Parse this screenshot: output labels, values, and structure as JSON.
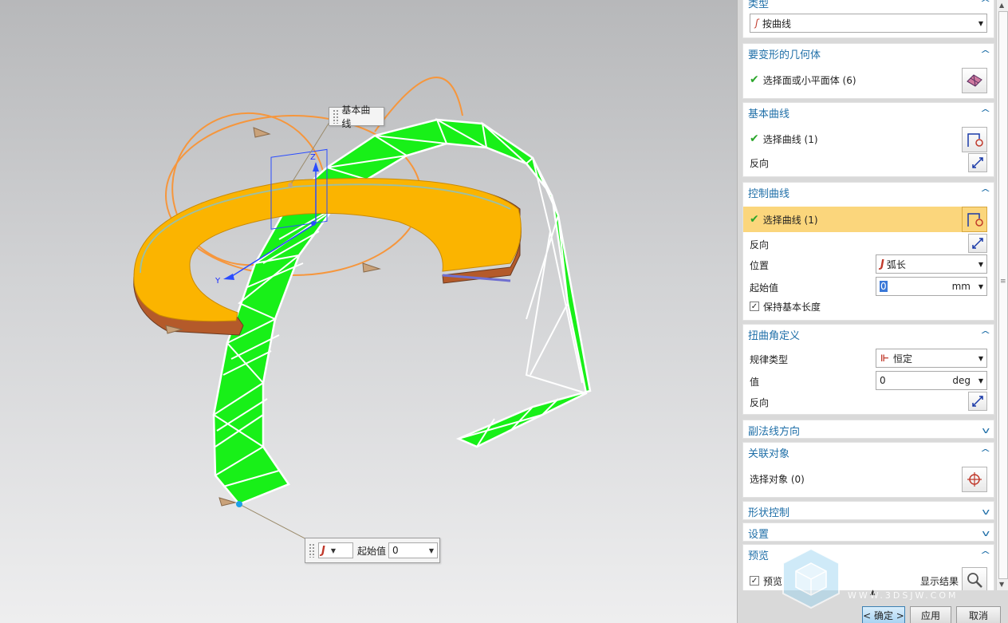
{
  "viewport": {
    "base_curve_callout": "基本曲线",
    "start_value_callout": {
      "label": "起始值",
      "value": "0"
    },
    "axis_z": "Z",
    "axis_y": "Y"
  },
  "panel": {
    "type_section": {
      "title": "类型",
      "dropdown_value": "按曲线"
    },
    "geometry_section": {
      "title": "要变形的几何体",
      "select_label": "选择面或小平面体 (6)"
    },
    "base_curve_section": {
      "title": "基本曲线",
      "select_label": "选择曲线 (1)",
      "reverse_label": "反向"
    },
    "control_curve_section": {
      "title": "控制曲线",
      "select_label": "选择曲线 (1)",
      "reverse_label": "反向",
      "position_label": "位置",
      "position_value": "弧长",
      "start_label": "起始值",
      "start_value": "0",
      "start_unit": "mm",
      "keep_length_label": "保持基本长度",
      "keep_length_checked": true
    },
    "twist_section": {
      "title": "扭曲角定义",
      "law_type_label": "规律类型",
      "law_type_value": "恒定",
      "value_label": "值",
      "value": "0",
      "value_unit": "deg",
      "reverse_label": "反向"
    },
    "binormal_section": {
      "title": "副法线方向"
    },
    "associated_section": {
      "title": "关联对象",
      "select_label": "选择对象 (0)"
    },
    "shape_control_section": {
      "title": "形状控制"
    },
    "settings_section": {
      "title": "设置"
    },
    "preview_section": {
      "title": "预览",
      "preview_label": "预览",
      "preview_checked": true,
      "show_result_label": "显示结果"
    }
  },
  "buttons": {
    "ok": "< 确定 >",
    "apply": "应用",
    "cancel": "取消"
  },
  "watermark": "WWW.3DSJW.COM",
  "colors": {
    "section_title": "#1f6fa8",
    "highlight_row": "#fbd67c",
    "mesh_green": "#18f018",
    "ring_orange": "#fbb400",
    "guide_orange": "#f6963c"
  }
}
